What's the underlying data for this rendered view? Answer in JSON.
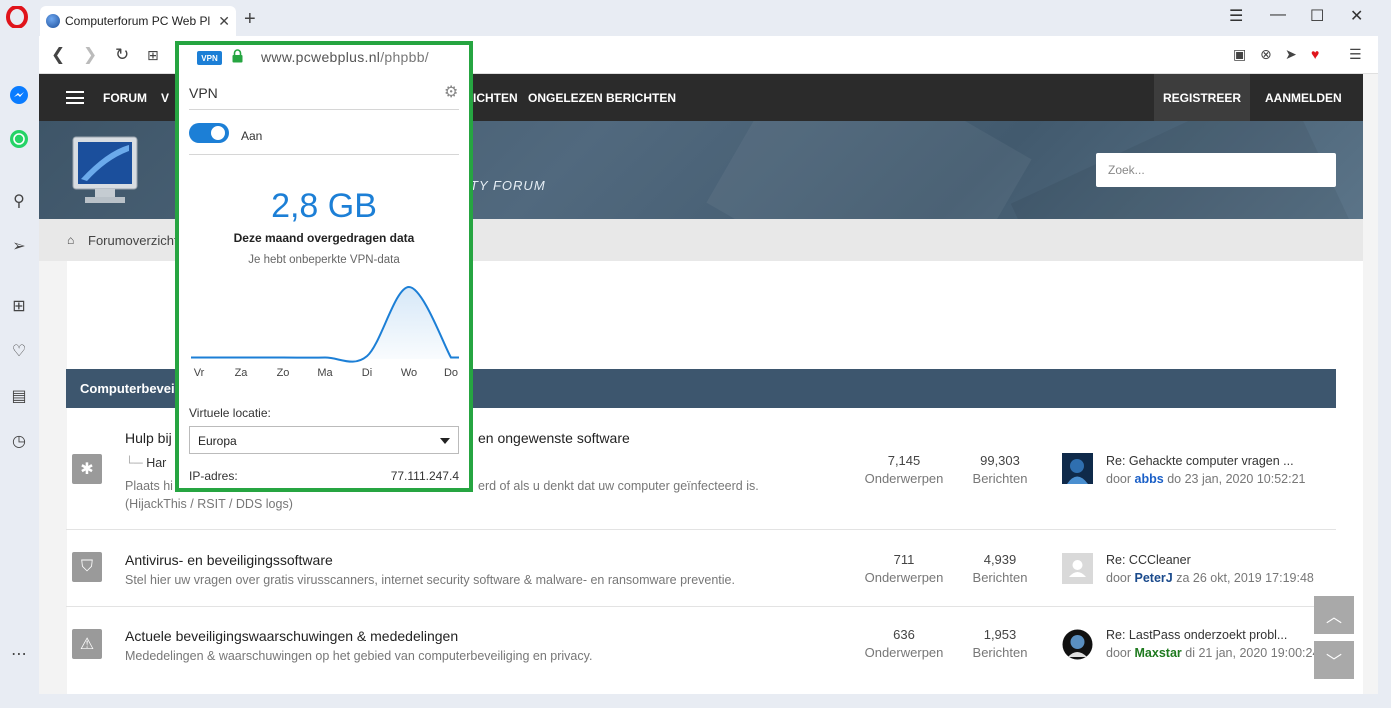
{
  "browser": {
    "tab_title": "Computerforum PC Web Pl",
    "address": {
      "badge": "VPN",
      "host": "www.pcwebplus.nl",
      "path": "/phpbb/"
    }
  },
  "site": {
    "nav": [
      "FORUM",
      "V",
      "ICHTEN",
      "ONGELEZEN BERICHTEN"
    ],
    "register": "REGISTREER",
    "login": "AANMELDEN",
    "hero_subtitle": "RITY FORUM",
    "search_placeholder": "Zoek...",
    "breadcrumb": "Forumoverzicht",
    "category_header": "Computerbeveili"
  },
  "forums": [
    {
      "title_left": "Hulp bij",
      "title_right": "en ongewenste software",
      "sub_left": "Har",
      "desc_left": "Plaats hi",
      "desc_right": "erd of als u denkt dat uw computer geïnfecteerd is.",
      "desc2": "(HijackThis / RSIT / DDS logs)",
      "topics": "7,145",
      "posts": "99,303",
      "last_title": "Re: Gehackte computer vragen ...",
      "last_by": "door",
      "last_user": "abbs",
      "last_date": "do 23 jan, 2020 10:52:21",
      "user_color": "#1a5fc7"
    },
    {
      "title": "Antivirus- en beveiligingssoftware",
      "desc": "Stel hier uw vragen over gratis virusscanners, internet security software & malware- en ransomware preventie.",
      "topics": "711",
      "posts": "4,939",
      "last_title": "Re: CCCleaner",
      "last_by": "door",
      "last_user": "PeterJ",
      "last_date": "za 26 okt, 2019 17:19:48",
      "user_color": "#1a4a8c"
    },
    {
      "title": "Actuele beveiligingswaarschuwingen & mededelingen",
      "desc": "Mededelingen & waarschuwingen op het gebied van computerbeveiliging en privacy.",
      "topics": "636",
      "posts": "1,953",
      "last_title": "Re: LastPass onderzoekt probl...",
      "last_by": "door",
      "last_user": "Maxstar",
      "last_date": "di 21 jan, 2020 19:00:24",
      "user_color": "#1f7a1f"
    }
  ],
  "labels": {
    "topics": "Onderwerpen",
    "posts": "Berichten"
  },
  "vpn": {
    "title": "VPN",
    "toggle_label": "Aan",
    "toggle_on": true,
    "amount": "2,8 GB",
    "amount_label": "Deze maand overgedragen data",
    "unlimited": "Je hebt onbeperkte VPN-data",
    "days": [
      "Vr",
      "Za",
      "Zo",
      "Ma",
      "Di",
      "Wo",
      "Do"
    ],
    "usage_relative": [
      0.02,
      0.02,
      0.02,
      0.02,
      0.04,
      1.0,
      0.02
    ],
    "location_label": "Virtuele locatie:",
    "location_value": "Europa",
    "ip_label": "IP-adres:",
    "ip_value": "77.111.247.4",
    "accent": "#1c7fd6",
    "frame_color": "#26a541"
  }
}
